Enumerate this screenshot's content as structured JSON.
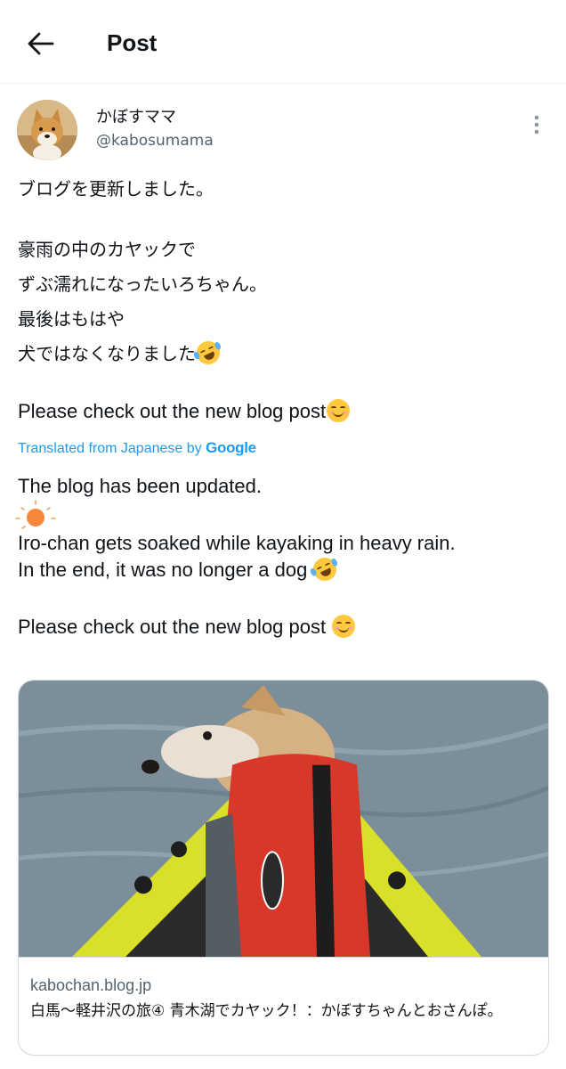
{
  "header": {
    "title": "Post"
  },
  "author": {
    "display_name": "かぼすママ",
    "handle": "@kabosumama"
  },
  "post": {
    "original_lines": [
      "ブログを更新しました。",
      "豪雨の中のカヤックで",
      "ずぶ濡れになったいろちゃん。",
      "最後はもはや",
      "犬ではなくなりました"
    ],
    "original_cta": "Please check out the new blog post",
    "translated_label": "Translated from Japanese by",
    "translated_provider": "Google",
    "translation_lines": [
      "The blog has been updated.",
      "Iro-chan gets soaked while kayaking in heavy rain.",
      "In the end, it was no longer a dog",
      "Please check out the new blog post"
    ]
  },
  "link_card": {
    "domain": "kabochan.blog.jp",
    "title": "白馬～軽井沢の旅④ 青木湖でカヤック！：かぼすちゃんとおさんぽ。"
  },
  "icons": {
    "back": "arrow-left-icon",
    "more": "more-vertical-icon",
    "smile": "smiling-face-emoji",
    "rofl": "rolling-on-floor-laughing-emoji",
    "sun": "sun-icon"
  },
  "colors": {
    "link": "#1d9bf0",
    "secondary_text": "#536471",
    "border": "#cfd9de"
  }
}
